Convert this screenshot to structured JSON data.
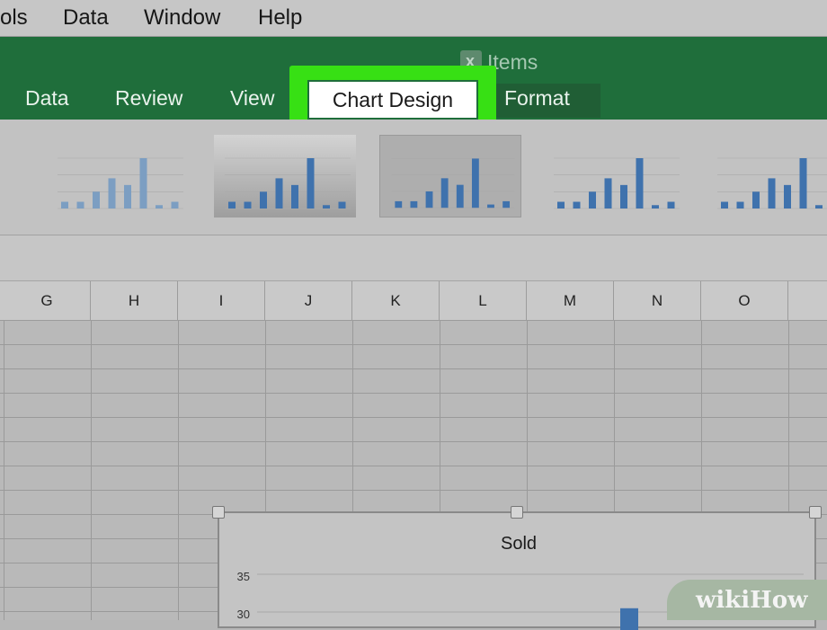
{
  "menubar": {
    "items": [
      "ols",
      "Data",
      "Window",
      "Help"
    ]
  },
  "ribbon": {
    "document_title": "Items",
    "tabs": [
      "Data",
      "Review",
      "View",
      "Chart Design",
      "Format"
    ],
    "active_tab": "Chart Design",
    "highlight_color": "#37e014",
    "ribbon_color": "#1f6e3b"
  },
  "chart_styles": [
    {
      "name": "style-1",
      "bars": [
        2,
        2,
        5,
        9,
        7,
        15,
        1,
        2
      ]
    },
    {
      "name": "style-2",
      "bars": [
        2,
        2,
        5,
        9,
        7,
        15,
        1,
        2
      ]
    },
    {
      "name": "style-3",
      "bars": [
        2,
        2,
        5,
        9,
        7,
        15,
        1,
        2
      ]
    },
    {
      "name": "style-4",
      "bars": [
        2,
        2,
        5,
        9,
        7,
        15,
        1,
        2
      ]
    },
    {
      "name": "style-5",
      "bars": [
        2,
        2,
        5,
        9,
        7,
        15,
        1,
        2
      ]
    }
  ],
  "columns": [
    "G",
    "H",
    "I",
    "J",
    "K",
    "L",
    "M",
    "N",
    "O"
  ],
  "chart": {
    "title": "Sold",
    "y_ticks": [
      "35",
      "30"
    ]
  },
  "chart_data": {
    "type": "bar",
    "title": "Sold",
    "ylim": [
      25,
      35
    ],
    "y_ticks": [
      30,
      35
    ],
    "visible_bar_values": [
      30.5
    ],
    "grid": true
  },
  "watermark": {
    "part_a": "wiki",
    "part_b": "How"
  }
}
